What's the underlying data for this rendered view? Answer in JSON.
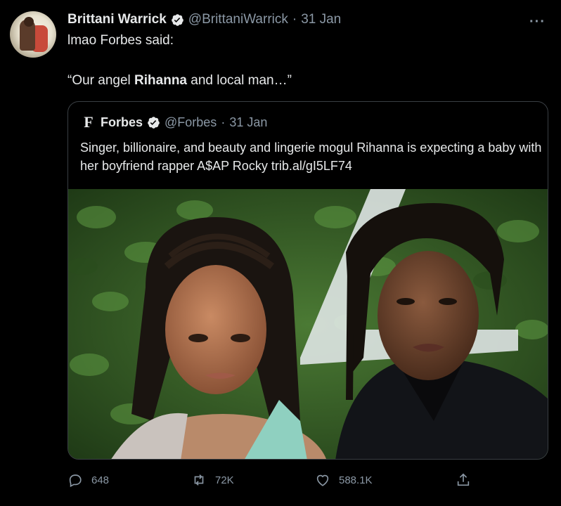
{
  "author": {
    "display_name": "Brittani Warrick",
    "handle": "@BrittaniWarrick",
    "date_sep": "·",
    "date": "31 Jan"
  },
  "tweet": {
    "line1": "lmao Forbes said:",
    "quote_open": "“Our angel ",
    "quote_bold": "Rihanna",
    "quote_close": " and local man…”"
  },
  "quoted": {
    "logo_letter": "F",
    "display_name": "Forbes",
    "handle": "@Forbes",
    "date_sep": "·",
    "date": "31 Jan",
    "text": "Singer, billionaire, and beauty and lingerie mogul Rihanna is expecting a baby with her boyfriend rapper A$AP Rocky trib.al/gI5LF74"
  },
  "actions": {
    "reply_count": "648",
    "retweet_count": "72K",
    "like_count": "588.1K"
  },
  "icons": {
    "verified": "verified-badge-icon",
    "more": "more-icon",
    "reply": "reply-icon",
    "retweet": "retweet-icon",
    "like": "heart-icon",
    "share": "share-icon"
  },
  "colors": {
    "background": "#000000",
    "text": "#e7e9ea",
    "muted": "#8b98a5",
    "border": "#3a3f44"
  }
}
